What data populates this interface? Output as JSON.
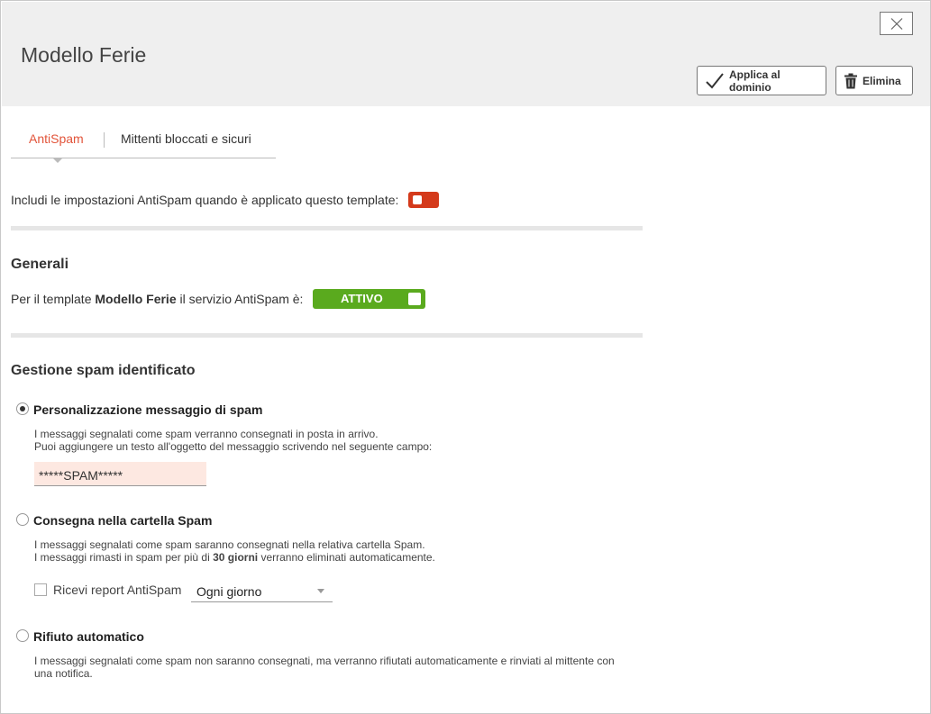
{
  "header": {
    "title": "Modello Ferie",
    "apply_label": "Applica al dominio",
    "delete_label": "Elimina"
  },
  "tabs": [
    {
      "label": "AntiSpam",
      "active": true
    },
    {
      "label": "Mittenti bloccati e sicuri",
      "active": false
    }
  ],
  "include_settings": {
    "label": "Includi le impostazioni AntiSpam quando è applicato questo template:",
    "enabled": false
  },
  "general": {
    "title": "Generali",
    "text_prefix": "Per il template",
    "template_name": "Modello Ferie",
    "text_suffix": "il servizio AntiSpam è:",
    "status_label": "ATTIVO"
  },
  "spam_handling": {
    "title": "Gestione spam identificato",
    "options": [
      {
        "label": "Personalizzazione messaggio di spam",
        "checked": true,
        "desc_lines": [
          "I messaggi segnalati come spam verranno consegnati in posta in arrivo.",
          "Puoi aggiungere un testo all'oggetto del messaggio scrivendo nel seguente campo:"
        ],
        "subject_value": "*****SPAM*****"
      },
      {
        "label": "Consegna nella cartella Spam",
        "checked": false,
        "desc_line1": "I messaggi segnalati come spam saranno consegnati nella relativa cartella Spam.",
        "desc_line2_prefix": "I messaggi rimasti in spam per più di",
        "desc_line2_bold": "30 giorni",
        "desc_line2_suffix": "verranno eliminati automaticamente.",
        "report_label": "Ricevi report AntiSpam",
        "report_checked": false,
        "report_frequency": "Ogni giorno"
      },
      {
        "label": "Rifiuto automatico",
        "checked": false,
        "desc_lines": [
          "I messaggi segnalati come spam non saranno consegnati, ma verranno rifiutati automaticamente e rinviati al mittente con",
          "una notifica."
        ]
      }
    ]
  },
  "colors": {
    "tab_active": "#e2543a",
    "toggle_off": "#d43a1b",
    "toggle_on": "#5aaa1e",
    "input_bg": "#fde8e1"
  }
}
